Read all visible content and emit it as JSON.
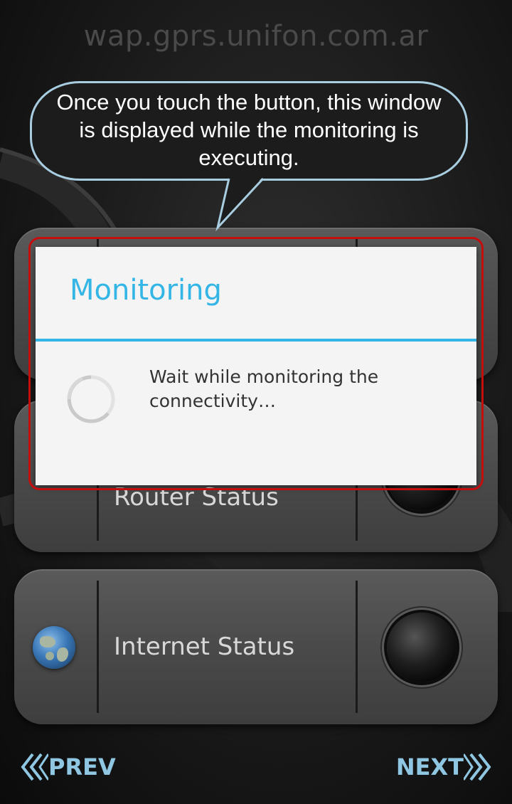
{
  "header": {
    "apn": "wap.gprs.unifon.com.ar"
  },
  "callout": {
    "text": "Once you touch the button, this window is displayed while the monitoring is executing."
  },
  "panels": {
    "middle": {
      "label": "Router Status"
    },
    "bottom": {
      "label": "Internet Status",
      "icon": "globe-icon"
    }
  },
  "dialog": {
    "title": "Monitoring",
    "message": "Wait while monitoring the connectivity…"
  },
  "nav": {
    "prev_label": "PREV",
    "next_label": "NEXT"
  },
  "colors": {
    "accent": "#33b5e5",
    "highlight": "#c40d0d",
    "nav": "#8fc7e3",
    "callout_border": "#a9cde0"
  }
}
